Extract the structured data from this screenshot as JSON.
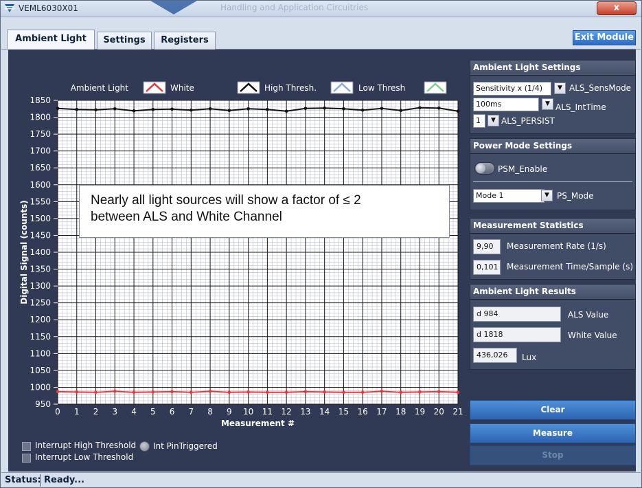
{
  "window": {
    "title": "VEML6030X01",
    "banner_text": "Handling and Application Circuitries",
    "close_glyph": "x"
  },
  "tabs": [
    {
      "label": "Ambient Light",
      "active": true
    },
    {
      "label": "Settings",
      "active": false
    },
    {
      "label": "Registers",
      "active": false
    }
  ],
  "exit_button": "Exit Module",
  "chart_legend": [
    {
      "name": "Ambient Light",
      "color": "#e8383c"
    },
    {
      "name": "White",
      "color": "#111111"
    },
    {
      "name": "High Thresh.",
      "color": "#8fa9d8"
    },
    {
      "name": "Low Thresh",
      "color": "#7fd08f"
    }
  ],
  "chart_data": {
    "type": "line",
    "xlabel": "Measurement #",
    "ylabel": "Digital Signal  (counts)",
    "xlim": [
      0,
      21
    ],
    "ylim": [
      950,
      1850
    ],
    "x_ticks": [
      0,
      1,
      2,
      3,
      4,
      5,
      6,
      7,
      8,
      9,
      10,
      11,
      12,
      13,
      14,
      15,
      16,
      17,
      18,
      19,
      20,
      21
    ],
    "y_ticks": [
      950,
      1000,
      1050,
      1100,
      1150,
      1200,
      1250,
      1300,
      1350,
      1400,
      1450,
      1500,
      1550,
      1600,
      1650,
      1700,
      1750,
      1800,
      1850
    ],
    "grid": true,
    "series": [
      {
        "name": "Ambient Light",
        "color": "#e8383c",
        "x": [
          0,
          1,
          2,
          3,
          4,
          5,
          6,
          7,
          8,
          9,
          10,
          11,
          12,
          13,
          14,
          15,
          16,
          17,
          18,
          19,
          20,
          21
        ],
        "values": [
          987,
          986,
          985,
          988,
          985,
          986,
          987,
          985,
          988,
          985,
          986,
          985,
          985,
          987,
          986,
          985,
          985,
          988,
          985,
          986,
          987,
          985
        ]
      },
      {
        "name": "White",
        "color": "#111111",
        "x": [
          0,
          1,
          2,
          3,
          4,
          5,
          6,
          7,
          8,
          9,
          10,
          11,
          12,
          13,
          14,
          15,
          16,
          17,
          18,
          19,
          20,
          21
        ],
        "values": [
          1826,
          1823,
          1822,
          1825,
          1819,
          1823,
          1824,
          1821,
          1825,
          1820,
          1825,
          1823,
          1818,
          1826,
          1827,
          1825,
          1821,
          1826,
          1820,
          1828,
          1827,
          1818
        ]
      }
    ]
  },
  "annotation": {
    "line1": "Nearly all light sources will show a factor of ≤ 2",
    "line2": "between ALS and White Channel"
  },
  "bottom_controls": {
    "int_high": "Interrupt High Threshold",
    "int_low": "Interrupt Low Threshold",
    "int_pin": "Int PinTriggered"
  },
  "ambient_settings": {
    "title": "Ambient Light Settings",
    "sens_value": "Sensitivity x (1/4)",
    "sens_label": "ALS_SensMode",
    "inttime_value": "100ms",
    "inttime_label": "ALS_IntTime",
    "persist_value": "1",
    "persist_label": "ALS_PERSIST"
  },
  "power_settings": {
    "title": "Power Mode Settings",
    "psm_label": "PSM_Enable",
    "mode_value": "Mode 1",
    "mode_label": "PS_Mode"
  },
  "statistics": {
    "title": "Measurement Statistics",
    "rate_value": "9,90",
    "rate_label": "Measurement Rate (1/s)",
    "time_value": "0,101",
    "time_label": "Measurement Time/Sample (s)"
  },
  "results": {
    "title": "Ambient Light Results",
    "als_value": "d 984",
    "als_label": "ALS Value",
    "white_value": "d 1818",
    "white_label": "White Value",
    "lux_value": "436,026",
    "lux_label": "Lux"
  },
  "buttons": {
    "clear": "Clear",
    "measure": "Measure",
    "stop": "Stop"
  },
  "status": {
    "label": "Status:",
    "value": "Ready..."
  }
}
